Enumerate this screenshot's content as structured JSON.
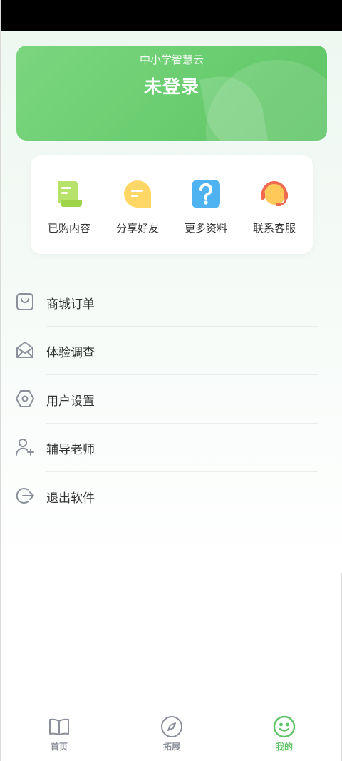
{
  "header": {
    "app_name": "中小学智慧云",
    "login_status": "未登录"
  },
  "quick_actions": [
    {
      "label": "已购内容",
      "icon": "document-icon"
    },
    {
      "label": "分享好友",
      "icon": "message-icon"
    },
    {
      "label": "更多资料",
      "icon": "question-icon"
    },
    {
      "label": "联系客服",
      "icon": "headset-icon"
    }
  ],
  "menu": [
    {
      "label": "商城订单",
      "icon": "shopping-bag-icon"
    },
    {
      "label": "体验调查",
      "icon": "mail-icon"
    },
    {
      "label": "用户设置",
      "icon": "settings-hexagon-icon"
    },
    {
      "label": "辅导老师",
      "icon": "add-user-icon"
    },
    {
      "label": "退出软件",
      "icon": "logout-icon"
    }
  ],
  "bottom_nav": [
    {
      "label": "首页",
      "icon": "book-icon",
      "active": false
    },
    {
      "label": "拓展",
      "icon": "compass-icon",
      "active": false
    },
    {
      "label": "我的",
      "icon": "smiley-icon",
      "active": true
    }
  ],
  "colors": {
    "accent": "#5fc466",
    "text": "#333333",
    "icon_gray": "#8a8f99"
  }
}
